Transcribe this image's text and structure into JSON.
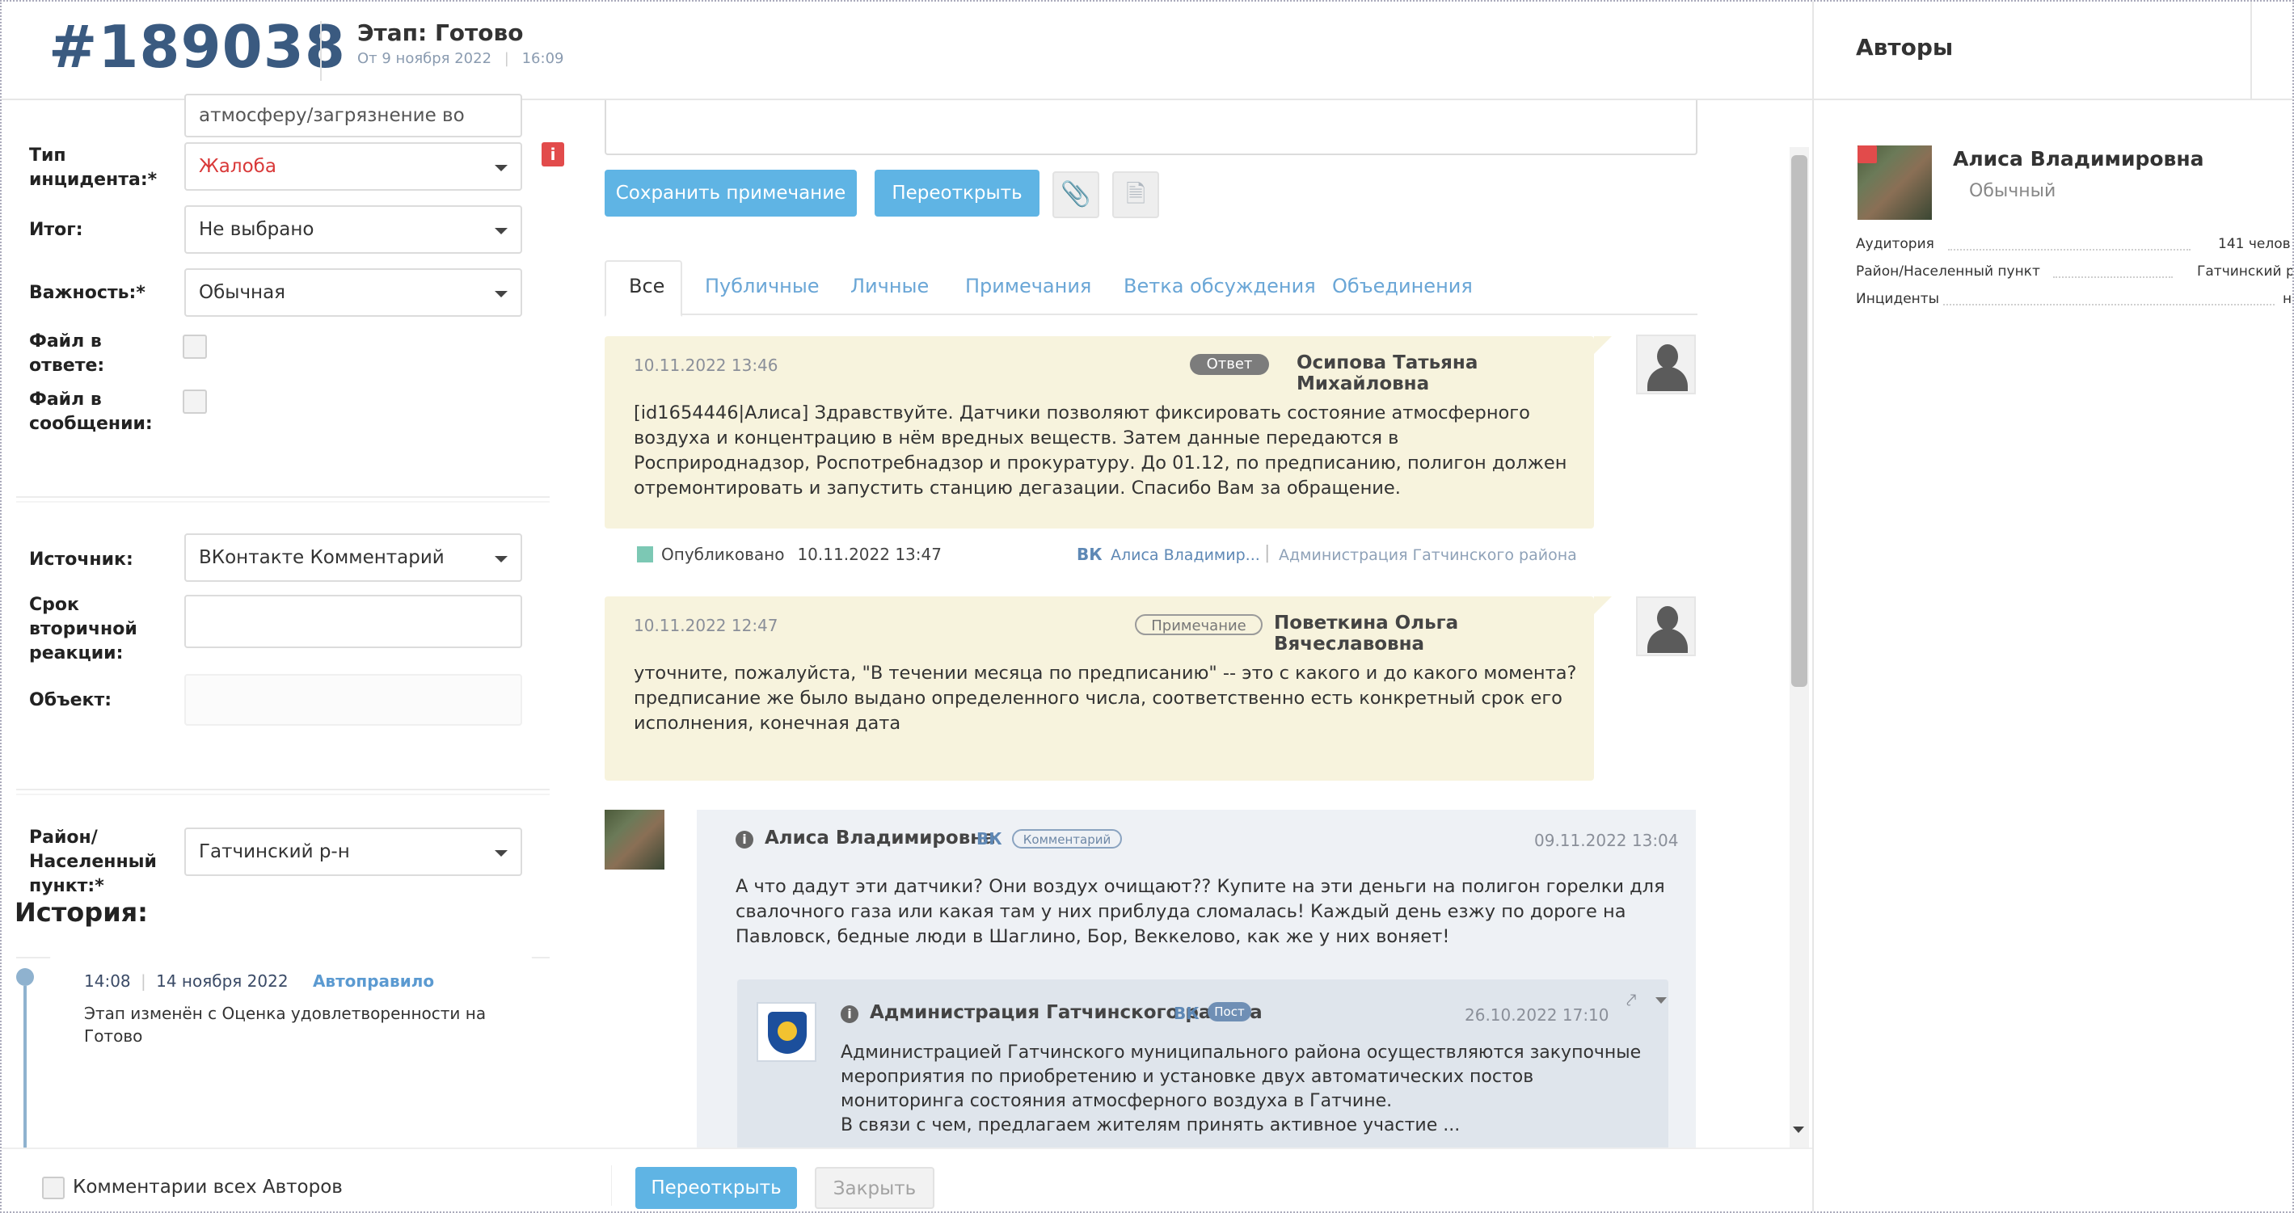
{
  "header": {
    "ticket_id": "#189038",
    "stage": "Этап: Готово",
    "stage_date": "От 9 ноября 2022",
    "stage_time": "16:09"
  },
  "left_form": {
    "top_field_value": "атмосферу/загрязнение во",
    "incident_type_label": "Тип инцидента:*",
    "incident_type_value": "Жалоба",
    "result_label": "Итог:",
    "result_value": "Не выбрано",
    "importance_label": "Важность:*",
    "importance_value": "Обычная",
    "file_in_answer_label": "Файл в ответе:",
    "file_in_message_label": "Файл в сообщении:",
    "source_label": "Источник:",
    "source_value": "ВКонтакте Комментарий",
    "secondary_deadline_label": "Срок вторичной реакции:",
    "object_label": "Объект:",
    "district_label": "Район/ Населенный пункт:*",
    "district_value": "Гатчинский р-н",
    "warning_icon": "i"
  },
  "history": {
    "title": "История:",
    "items": [
      {
        "time": "14:08",
        "date": "14 ноября 2022",
        "actor": "Автоправило",
        "text_line1": "Этап изменён с Оценка удовлетворенности на",
        "text_line2": "Готово"
      }
    ]
  },
  "actions": {
    "save_note": "Сохранить примечание",
    "reopen_top": "Переоткрыть",
    "paperclip_icon": "📎",
    "document_icon": "🗎"
  },
  "tabs": [
    "Все",
    "Публичные",
    "Личные",
    "Примечания",
    "Ветка обсуждения",
    "Объединения"
  ],
  "feed": {
    "reply": {
      "time": "10.11.2022 13:46",
      "badge": "Ответ",
      "author": "Осипова Татьяна Михайловна",
      "text": "[id1654446|Алиса] Здравствуйте. Датчики позволяют фиксировать состояние атмосферного\nвоздуха и концентрацию в нём вредных веществ. Затем данные передаются в\nРосприроднадзор, Роспотребнадзор и прокуратуру. До 01.12, по предписанию, полигон должен\nотремонтировать и запустить станцию дегазации. Спасибо Вам за обращение.",
      "status": "Опубликовано",
      "status_time": "10.11.2022 13:47",
      "vk_label": "ВК",
      "vk_author": "Алиса Владимир...",
      "vk_target": "Администрация Гатчинского района"
    },
    "note": {
      "time": "10.11.2022 12:47",
      "badge": "Примечание",
      "author": "Поветкина Ольга Вячеславовна",
      "text": "уточните, пожалуйста, \"В течении месяца по предписанию\" -- это с какого и до какого момента?\nпредписание же было выдано определенного числа, соответственно есть конкретный срок его\nисполнения, конечная дата"
    },
    "comment": {
      "author": "Алиса Владимировна",
      "vk_label": "ВК",
      "badge": "Комментарий",
      "time": "09.11.2022 13:04",
      "text": "А что дадут эти датчики? Они воздух очищают?? Купите на эти деньги на полигон горелки для\nсвалочного газа или какая там у них приблуда сломалась! Каждый день езжу по дороге на\nПавловск, бедные люди в Шаглино, Бор, Веккелово, как же у них воняет!"
    },
    "post": {
      "author": "Администрация Гатчинского района",
      "vk_label": "ВК",
      "badge": "Пост",
      "time": "26.10.2022 17:10",
      "text": "Администрацией Гатчинского муниципального района осуществляются закупочные\nмероприятия по приобретению и установке двух автоматических постов\nмониторинга состояния атмосферного воздуха в Гатчине.\nВ связи с чем, предлагаем жителям принять активное участие ..."
    }
  },
  "bottom": {
    "all_authors_comments": "Комментарии всех Авторов",
    "reopen": "Переоткрыть",
    "close": "Закрыть"
  },
  "authors_panel": {
    "title": "Авторы",
    "name": "Алиса Владимировна",
    "type": "Обычный",
    "audience_label": "Аудитория",
    "audience_value": "141 челов",
    "district_label": "Район/Населенный пункт",
    "district_value": "Гатчинский р",
    "incidents_label": "Инциденты",
    "incidents_value": "н"
  }
}
